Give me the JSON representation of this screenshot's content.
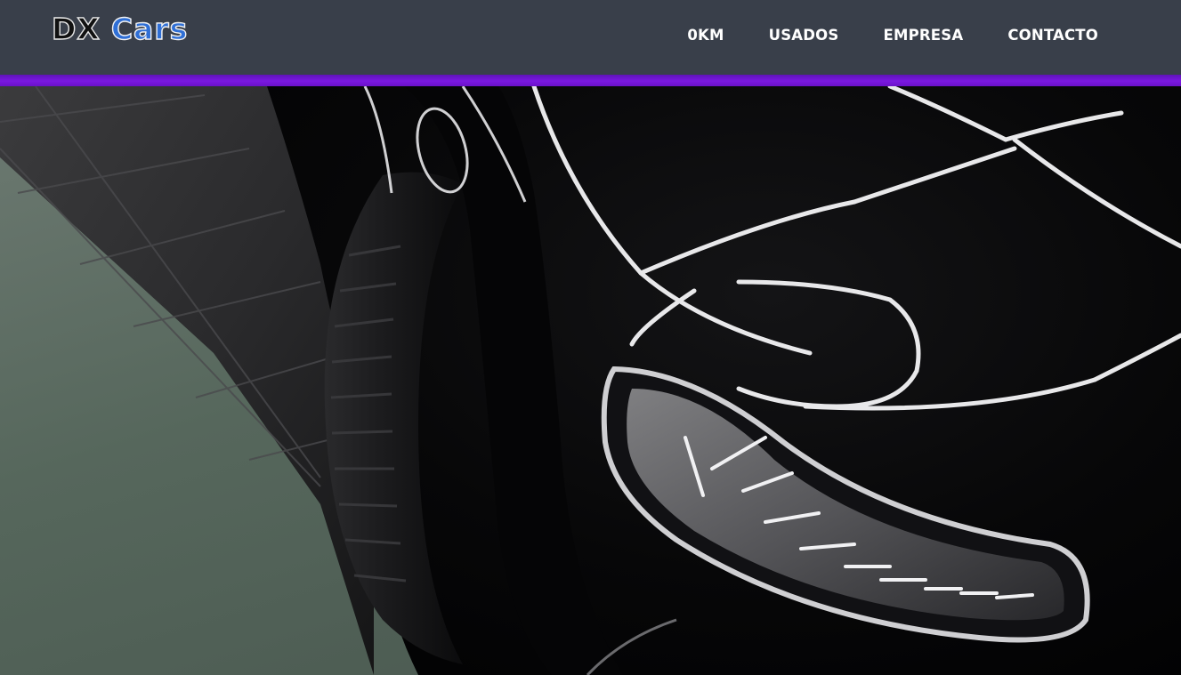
{
  "header": {
    "logo": {
      "part1": "DX",
      "part2": "Cars"
    },
    "nav": [
      {
        "label": "0KM"
      },
      {
        "label": "USADOS"
      },
      {
        "label": "EMPRESA"
      },
      {
        "label": "CONTACTO"
      }
    ]
  },
  "hero": {
    "image_subject": "black luxury car headlight and front wheel in showroom"
  },
  "colors": {
    "navbar_bg": "#393f4a",
    "accent_bar": "#7a18e0",
    "logo_blue": "#2f6fd6",
    "nav_text": "#ffffff"
  }
}
